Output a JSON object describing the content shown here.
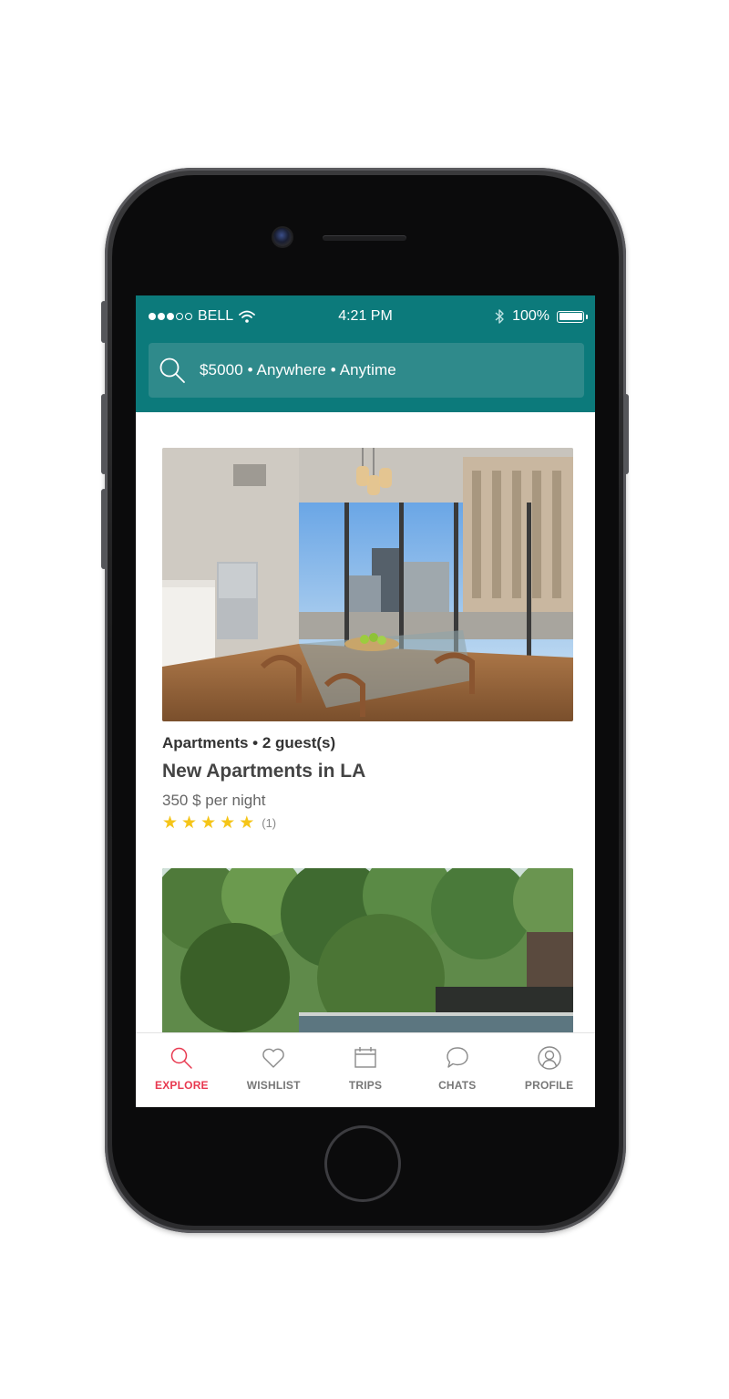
{
  "status_bar": {
    "carrier": "BELL",
    "time": "4:21 PM",
    "battery": "100%",
    "signal_bars": 3,
    "signal_total": 5
  },
  "search": {
    "text": "$5000 • Anywhere • Anytime",
    "icon": "search-icon"
  },
  "listings": [
    {
      "meta": "Apartments • 2 guest(s)",
      "title": "New Apartments in LA",
      "price": "350 $ per night",
      "rating_stars": 5,
      "review_count": "(1)",
      "photo": "apartment-interior-photo"
    },
    {
      "photo": "tropical-garden-pool-photo"
    }
  ],
  "tabs": [
    {
      "label": "EXPLORE",
      "icon": "search-icon",
      "active": true
    },
    {
      "label": "WISHLIST",
      "icon": "heart-icon",
      "active": false
    },
    {
      "label": "TRIPS",
      "icon": "calendar-icon",
      "active": false
    },
    {
      "label": "CHATS",
      "icon": "chat-bubble-icon",
      "active": false
    },
    {
      "label": "PROFILE",
      "icon": "user-circle-icon",
      "active": false
    }
  ],
  "colors": {
    "header": "#0c7a7b",
    "search_field": "#2f8a8b",
    "active_tab": "#e8384f",
    "inactive_tab": "#777777",
    "star": "#f5c518"
  }
}
